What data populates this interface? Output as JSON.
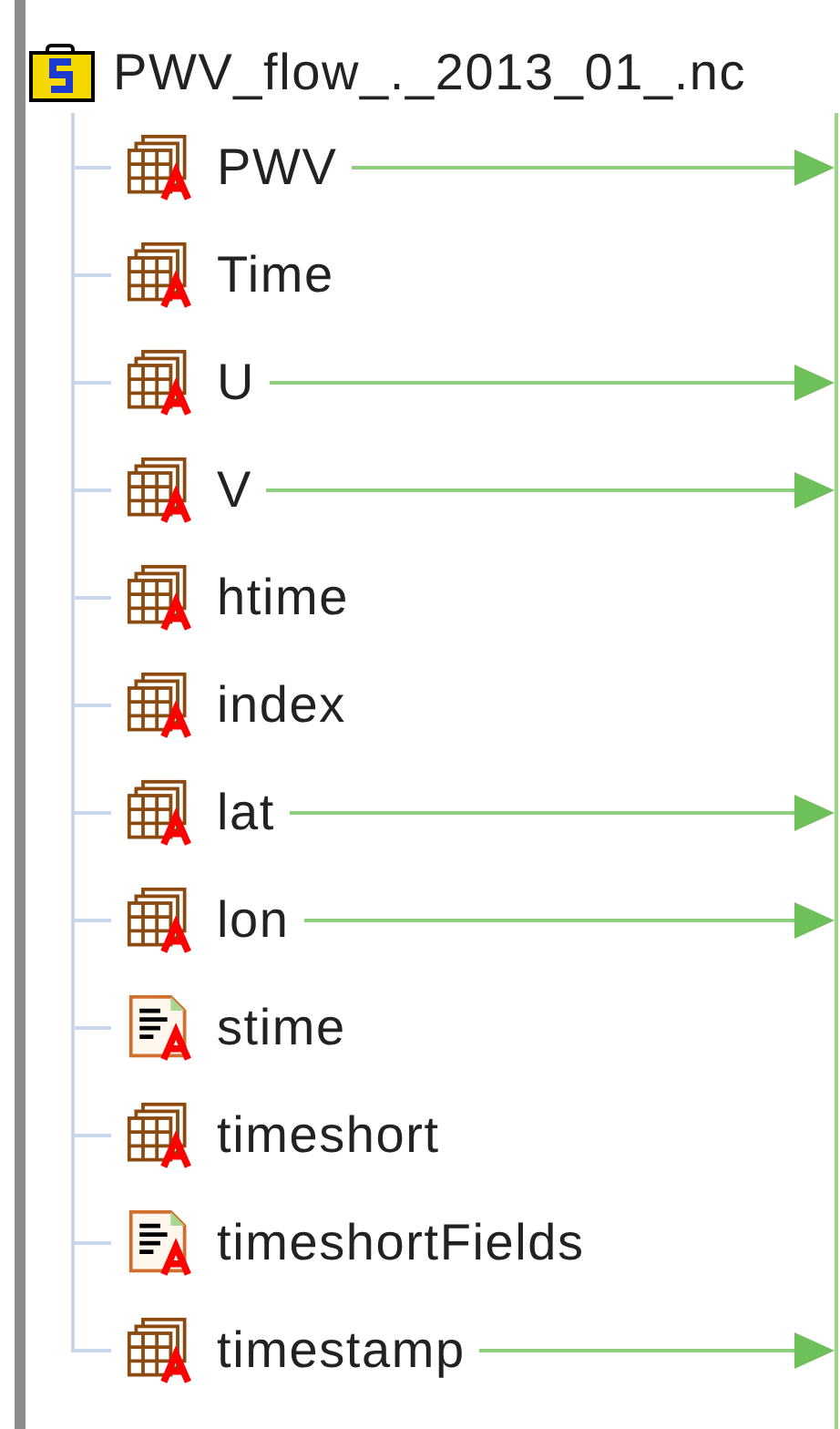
{
  "tree": {
    "root": {
      "label": "PWV_flow_._2013_01_.nc",
      "children": [
        {
          "label": "PWV",
          "kind": "grid",
          "linked": true
        },
        {
          "label": "Time",
          "kind": "grid",
          "linked": false
        },
        {
          "label": "U",
          "kind": "grid",
          "linked": true
        },
        {
          "label": "V",
          "kind": "grid",
          "linked": true
        },
        {
          "label": "htime",
          "kind": "grid",
          "linked": false
        },
        {
          "label": "index",
          "kind": "grid",
          "linked": false
        },
        {
          "label": "lat",
          "kind": "grid",
          "linked": true
        },
        {
          "label": "lon",
          "kind": "grid",
          "linked": true
        },
        {
          "label": "stime",
          "kind": "text",
          "linked": false
        },
        {
          "label": "timeshort",
          "kind": "grid",
          "linked": false
        },
        {
          "label": "timeshortFields",
          "kind": "text",
          "linked": false
        },
        {
          "label": "timestamp",
          "kind": "grid",
          "linked": true
        }
      ]
    }
  }
}
